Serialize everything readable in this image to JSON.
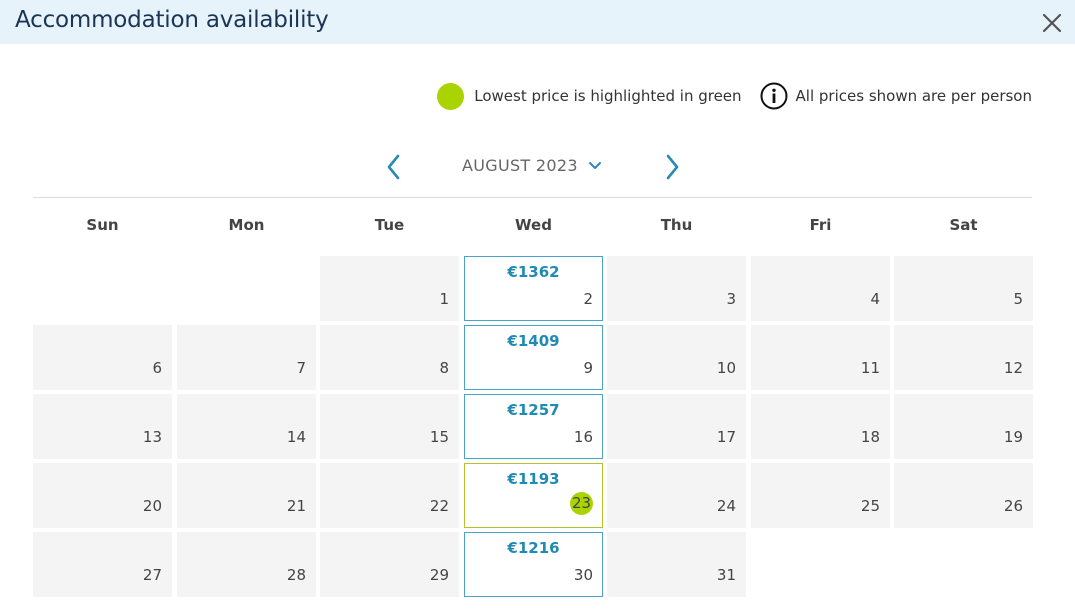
{
  "header": {
    "title": "Accommodation availability",
    "close_icon": "close-icon"
  },
  "legend": {
    "lowest_label": "Lowest price is highlighted in green",
    "per_person_label": "All prices shown are per person",
    "lowest_color": "#a9d400",
    "info_icon": "info-icon"
  },
  "month_nav": {
    "month_label": "AUGUST 2023",
    "prev_icon": "chevron-left-icon",
    "next_icon": "chevron-right-icon",
    "dropdown_icon": "chevron-down-icon"
  },
  "colors": {
    "accent": "#1f8ab3",
    "title_bar": "#e6f3fb",
    "cell_bg": "#f4f4f4",
    "lowest_highlight": "#a9d400"
  },
  "weekdays": [
    "Sun",
    "Mon",
    "Tue",
    "Wed",
    "Thu",
    "Fri",
    "Sat"
  ],
  "calendar": {
    "first_weekday_index": 2,
    "days_in_month": 31,
    "days": [
      {
        "day": "1"
      },
      {
        "day": "2",
        "price": "€1362"
      },
      {
        "day": "3"
      },
      {
        "day": "4"
      },
      {
        "day": "5"
      },
      {
        "day": "6"
      },
      {
        "day": "7"
      },
      {
        "day": "8"
      },
      {
        "day": "9",
        "price": "€1409"
      },
      {
        "day": "10"
      },
      {
        "day": "11"
      },
      {
        "day": "12"
      },
      {
        "day": "13"
      },
      {
        "day": "14"
      },
      {
        "day": "15"
      },
      {
        "day": "16",
        "price": "€1257"
      },
      {
        "day": "17"
      },
      {
        "day": "18"
      },
      {
        "day": "19"
      },
      {
        "day": "20"
      },
      {
        "day": "21"
      },
      {
        "day": "22"
      },
      {
        "day": "23",
        "price": "€1193",
        "lowest": true
      },
      {
        "day": "24"
      },
      {
        "day": "25"
      },
      {
        "day": "26"
      },
      {
        "day": "27"
      },
      {
        "day": "28"
      },
      {
        "day": "29"
      },
      {
        "day": "30",
        "price": "€1216"
      },
      {
        "day": "31"
      }
    ]
  }
}
